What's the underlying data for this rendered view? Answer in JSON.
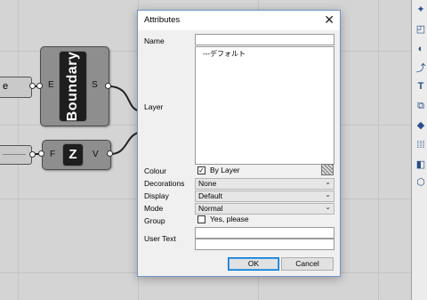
{
  "canvas": {
    "boundary_component": {
      "name": "Boundary",
      "input_port": "E",
      "output_port": "S"
    },
    "unit_z_component": {
      "name": "Z",
      "input_port": "F",
      "output_port": "V"
    },
    "panel_left_text": "e"
  },
  "dialog": {
    "title": "Attributes",
    "close_glyph": "✕",
    "labels": {
      "name": "Name",
      "layer": "Layer",
      "colour": "Colour",
      "decorations": "Decorations",
      "display": "Display",
      "mode": "Mode",
      "group": "Group",
      "user_text": "User Text"
    },
    "name_value": "",
    "layer_items": [
      "---デフォルト"
    ],
    "colour": {
      "by_layer_checked": true,
      "by_layer_label": "By Layer"
    },
    "decorations": {
      "selected": "None"
    },
    "display": {
      "selected": "Default"
    },
    "mode": {
      "selected": "Normal"
    },
    "group": {
      "checked": false,
      "label": "Yes, please"
    },
    "user_text": {
      "key": "",
      "value": ""
    },
    "buttons": {
      "ok": "OK",
      "cancel": "Cancel"
    }
  },
  "toolbar": {
    "icons": [
      "point-icon",
      "surface-icon",
      "curve-icon",
      "text-icon",
      "array-icon",
      "box-icon",
      "grid-icon",
      "extrude-icon",
      "mesh-icon"
    ]
  },
  "colors": {
    "canvas_bg": "#d4d4d4",
    "component_fill": "#8e8e8e",
    "dialog_border": "#6e95c8",
    "ok_button_border": "#0078d7"
  }
}
